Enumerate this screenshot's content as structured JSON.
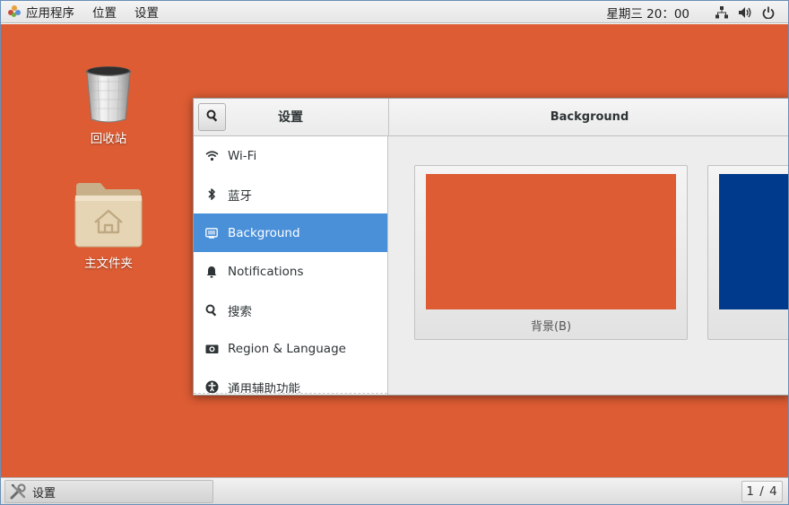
{
  "top_panel": {
    "menus": [
      "应用程序",
      "位置",
      "设置"
    ],
    "clock": "星期三 20：00",
    "tray_icons": [
      "network-icon",
      "volume-icon",
      "power-icon"
    ]
  },
  "desktop": {
    "background_color": "#dd5c33",
    "icons": [
      {
        "label": "回收站",
        "icon": "trash-icon"
      },
      {
        "label": "主文件夹",
        "icon": "home-folder-icon"
      }
    ]
  },
  "settings_window": {
    "title": "设置",
    "panel_title": "Background",
    "sidebar": [
      {
        "label": "Wi-Fi",
        "icon": "wifi-icon",
        "active": false
      },
      {
        "label": "蓝牙",
        "icon": "bluetooth-icon",
        "active": false
      },
      {
        "label": "Background",
        "icon": "background-icon",
        "active": true
      },
      {
        "label": "Notifications",
        "icon": "bell-icon",
        "active": false
      },
      {
        "label": "搜索",
        "icon": "search-icon",
        "active": false
      },
      {
        "label": "Region & Language",
        "icon": "region-icon",
        "active": false
      },
      {
        "label": "通用辅助功能",
        "icon": "accessibility-icon",
        "active": false
      }
    ],
    "backgrounds": [
      {
        "label": "背景(B)",
        "color": "#dd5c33"
      },
      {
        "label": "",
        "color": "#003a8c"
      }
    ],
    "accent_color": "#4a90d9"
  },
  "bottom_panel": {
    "task": {
      "label": "设置",
      "icon": "settings-tools-icon"
    },
    "workspace": "1 / 4"
  }
}
